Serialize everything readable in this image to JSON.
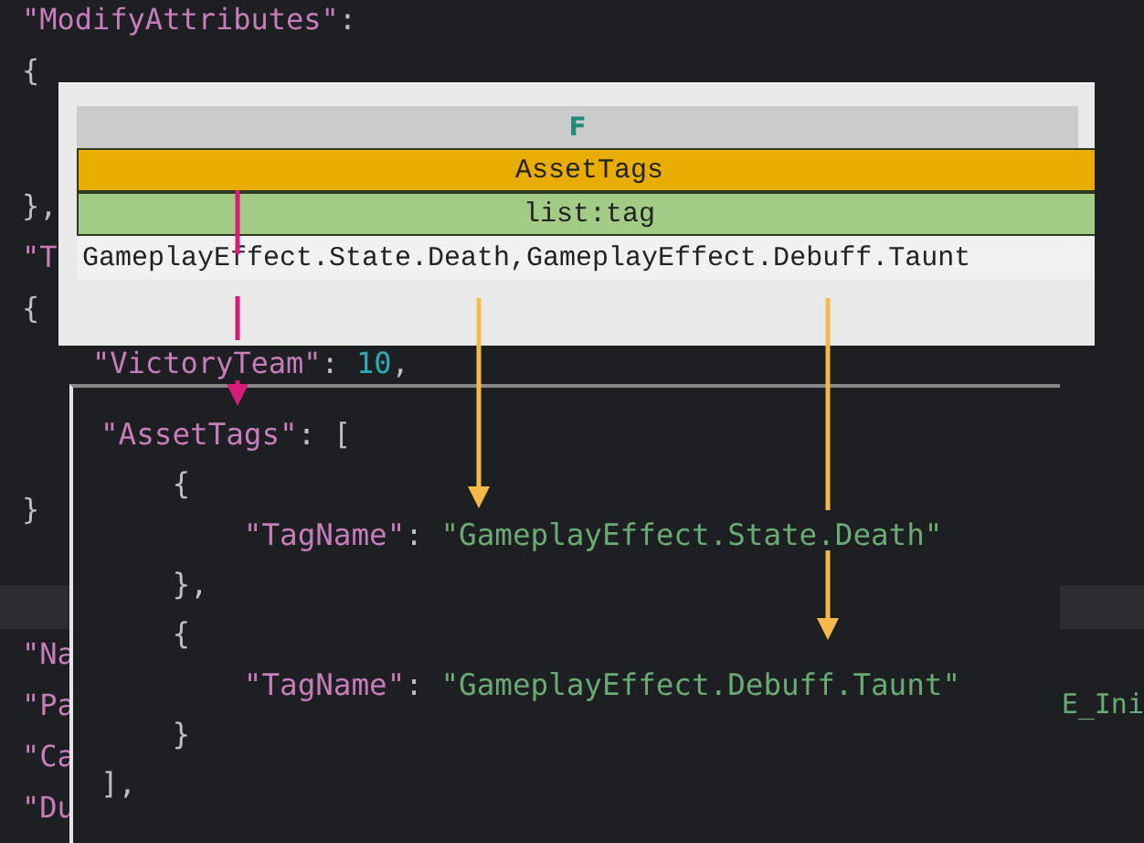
{
  "editor": {
    "lines": [
      {
        "tokens": [
          {
            "kind": "key",
            "text": "\"ModifyAttributes\""
          },
          {
            "kind": "punct",
            "text": ":"
          }
        ]
      },
      {
        "tokens": [
          {
            "kind": "punct",
            "text": "{"
          }
        ]
      },
      {
        "tokens": [
          {
            "kind": "punct",
            "text": "},"
          }
        ]
      },
      {
        "tokens": [
          {
            "kind": "key",
            "text": "\"T"
          }
        ]
      },
      {
        "tokens": [
          {
            "kind": "punct",
            "text": "{"
          }
        ]
      },
      {
        "tokens": [
          {
            "kind": "key",
            "text": "    \"VictoryTeam\""
          },
          {
            "kind": "punct",
            "text": ": "
          },
          {
            "kind": "number",
            "text": "10"
          },
          {
            "kind": "punct",
            "text": ","
          }
        ]
      },
      {
        "tokens": [
          {
            "kind": "punct",
            "text": "}"
          }
        ]
      },
      {
        "tokens": [
          {
            "kind": "key",
            "text": "\"Na"
          }
        ]
      },
      {
        "tokens": [
          {
            "kind": "key",
            "text": "\"Pa"
          }
        ],
        "tail": "E_Ini"
      },
      {
        "tokens": [
          {
            "kind": "key",
            "text": "\"Ca"
          }
        ]
      },
      {
        "tokens": [
          {
            "kind": "key",
            "text": "\"Du"
          }
        ]
      }
    ]
  },
  "table": {
    "column_header": "F",
    "rows": [
      {
        "kind": "name",
        "text": "AssetTags"
      },
      {
        "kind": "type",
        "text": "list:tag"
      },
      {
        "kind": "value",
        "text": "GameplayEffect.State.Death,GameplayEffect.Debuff.Taunt"
      }
    ]
  },
  "json_panel": {
    "lines": [
      {
        "tokens": [
          {
            "kind": "key",
            "text": "\"AssetTags\""
          },
          {
            "kind": "punct",
            "text": ": ["
          }
        ]
      },
      {
        "tokens": [
          {
            "kind": "punct",
            "text": "    {"
          }
        ]
      },
      {
        "tokens": [
          {
            "kind": "key",
            "text": "        \"TagName\""
          },
          {
            "kind": "punct",
            "text": ": "
          },
          {
            "kind": "string",
            "text": "\"GameplayEffect.State.Death\""
          }
        ]
      },
      {
        "tokens": [
          {
            "kind": "punct",
            "text": "    },"
          }
        ]
      },
      {
        "tokens": [
          {
            "kind": "punct",
            "text": "    {"
          }
        ]
      },
      {
        "tokens": [
          {
            "kind": "key",
            "text": "        \"TagName\""
          },
          {
            "kind": "punct",
            "text": ": "
          },
          {
            "kind": "string",
            "text": "\"GameplayEffect.Debuff.Taunt\""
          }
        ]
      },
      {
        "tokens": [
          {
            "kind": "punct",
            "text": "    }"
          }
        ]
      },
      {
        "tokens": [
          {
            "kind": "punct",
            "text": "],"
          }
        ]
      }
    ]
  }
}
